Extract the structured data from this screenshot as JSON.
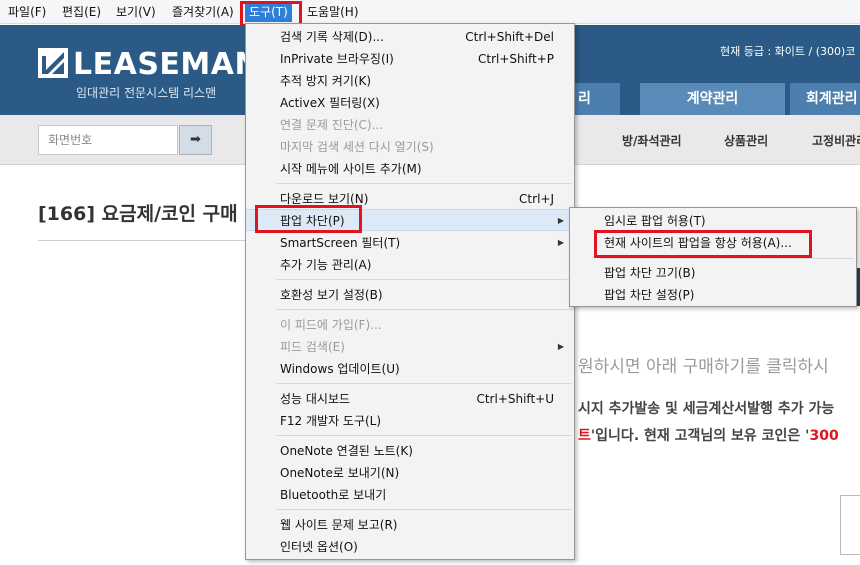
{
  "menubar": {
    "items": [
      "파일(F)",
      "편집(E)",
      "보기(V)",
      "즐겨찾기(A)",
      "도구(T)",
      "도움말(H)"
    ]
  },
  "site": {
    "logo_text": "LEASEMAN",
    "logo_sub": "임대관리 전문시스템 리스맨",
    "grade": "현재 등급 : 화이트 / (300)코",
    "topnav": [
      "리",
      "계약관리",
      "회계관리"
    ],
    "screen_placeholder": "화면번호",
    "go_arrow": "➡",
    "subnav": [
      "방/좌석관리",
      "상품관리",
      "고정비관리"
    ],
    "page_title": "[166] 요금제/코인 구매",
    "line1": "원하시면 아래 구매하기를 클릭하시",
    "line2": "시지 추가발송 및 세금계산서발행 추가 가능",
    "line3_red1": "트",
    "line3_mid": "'입니다. 현재 고객님의 보유 코인은 '",
    "line3_red2": "300"
  },
  "tools_menu": {
    "delete_history": "검색 기록 삭제(D)...",
    "delete_history_sc": "Ctrl+Shift+Del",
    "inprivate": "InPrivate 브라우징(I)",
    "inprivate_sc": "Ctrl+Shift+P",
    "tracking": "추적 방지 켜기(K)",
    "activex": "ActiveX 필터링(X)",
    "diagnose": "연결 문제 진단(C)...",
    "reopen": "마지막 검색 세션 다시 열기(S)",
    "start_menu": "시작 메뉴에 사이트 추가(M)",
    "downloads": "다운로드 보기(N)",
    "downloads_sc": "Ctrl+J",
    "popup_blocker": "팝업 차단(P)",
    "smartscreen": "SmartScreen 필터(T)",
    "addons": "추가 기능 관리(A)",
    "compat": "호환성 보기 설정(B)",
    "subscribe": "이 피드에 가입(F)...",
    "feed_search": "피드 검색(E)",
    "windows_update": "Windows 업데이트(U)",
    "perf": "성능 대시보드",
    "perf_sc": "Ctrl+Shift+U",
    "f12": "F12 개발자 도구(L)",
    "onenote_linked": "OneNote 연결된 노트(K)",
    "onenote_send": "OneNote로 보내기(N)",
    "bluetooth": "Bluetooth로 보내기",
    "report": "웹 사이트 문제 보고(R)",
    "options": "인터넷 옵션(O)"
  },
  "popup_submenu": {
    "allow_temp": "임시로 팝업 허용(T)",
    "allow_always": "현재 사이트의 팝업을 항상 허용(A)...",
    "turn_off": "팝업 차단 끄기(B)",
    "settings": "팝업 차단 설정(P)"
  },
  "colors": {
    "highlight_box": "#e0141e",
    "menu_active": "#2f7fd8",
    "header_bg": "#2a5a85"
  }
}
